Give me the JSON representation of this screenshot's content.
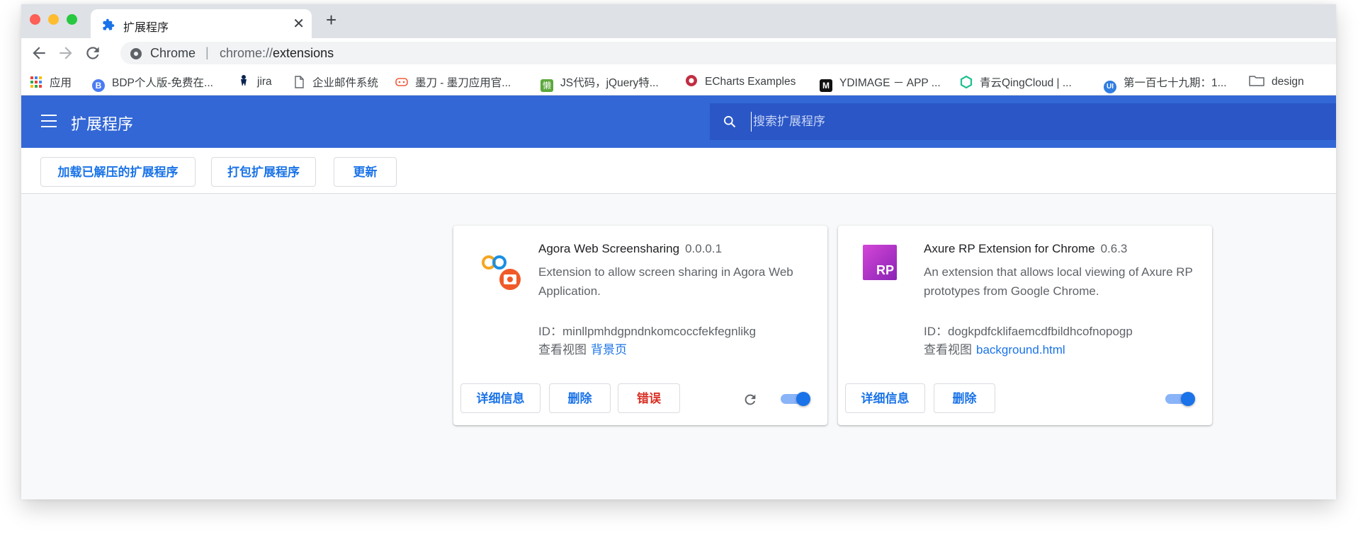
{
  "tab": {
    "title": "扩展程序"
  },
  "omnibox": {
    "site": "Chrome",
    "separator": "|",
    "url_prefix": "chrome://",
    "url_path": "extensions"
  },
  "bookmarks": [
    {
      "label": "应用",
      "icon": "apps-grid-icon",
      "color": "#ea4335"
    },
    {
      "label": "BDP个人版-免费在...",
      "icon": "bdp-icon",
      "color": "#4a7cf3"
    },
    {
      "label": "jira",
      "icon": "jira-icon",
      "color": "#0a2352"
    },
    {
      "label": "企业邮件系统",
      "icon": "document-icon",
      "color": "#5f6368"
    },
    {
      "label": "墨刀 - 墨刀应用官...",
      "icon": "modao-icon",
      "color": "#ef5b3a"
    },
    {
      "label": "JS代码，jQuery特...",
      "icon": "lan-icon",
      "color": "#5ca83c"
    },
    {
      "label": "ECharts Examples",
      "icon": "echarts-icon",
      "color": "#c12e42"
    },
    {
      "label": "YDIMAGE － APP ...",
      "icon": "ydimage-icon",
      "color": "#111111"
    },
    {
      "label": "青云QingCloud | ...",
      "icon": "qingcloud-icon",
      "color": "#1fbf8f"
    },
    {
      "label": "第一百七十九期：1...",
      "icon": "ui-icon",
      "color": "#2f7de1"
    },
    {
      "label": "design",
      "icon": "folder-icon",
      "color": "#5f6368"
    }
  ],
  "header": {
    "title": "扩展程序",
    "search_placeholder": "搜索扩展程序"
  },
  "actions": {
    "load_unpacked": "加载已解压的扩展程序",
    "pack": "打包扩展程序",
    "update": "更新"
  },
  "extensions": [
    {
      "name": "Agora Web Screensharing",
      "version": "0.0.0.1",
      "description": "Extension to allow screen sharing in Agora Web Application.",
      "id_label": "ID：",
      "id": "minllpmhdgpndnkomcoccfekfegnlikg",
      "views_label": "查看视图",
      "view_link": "背景页",
      "details": "详细信息",
      "remove": "删除",
      "errors": "错误",
      "enabled": true
    },
    {
      "name": "Axure RP Extension for Chrome",
      "version": "0.6.3",
      "description": "An extension that allows local viewing of Axure RP prototypes from Google Chrome.",
      "id_label": "ID：",
      "id": "dogkpdfcklifaemcdfbildhcofnopogp",
      "views_label": "查看视图",
      "view_link": "background.html",
      "details": "详细信息",
      "remove": "删除",
      "icon_text": "RP",
      "enabled": true
    }
  ]
}
